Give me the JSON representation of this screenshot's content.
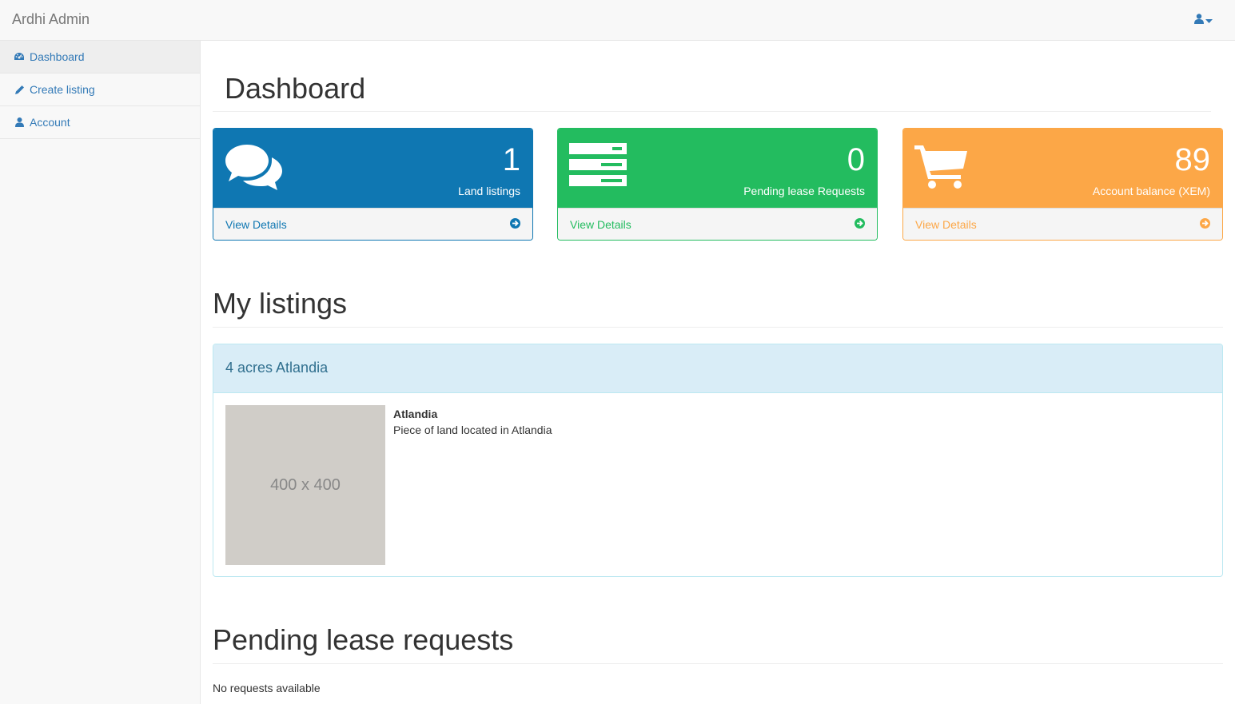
{
  "app": {
    "brand": "Ardhi Admin"
  },
  "navbar": {
    "user_icon": "user-icon",
    "caret_icon": "caret-down-icon"
  },
  "sidebar": {
    "items": [
      {
        "label": "Dashboard",
        "icon": "dashboard-icon",
        "active": true
      },
      {
        "label": "Create listing",
        "icon": "pencil-icon",
        "active": false
      },
      {
        "label": "Account",
        "icon": "user-icon",
        "active": false
      }
    ]
  },
  "main": {
    "title": "Dashboard",
    "cards": [
      {
        "value": "1",
        "label": "Land listings",
        "link": "View Details",
        "icon": "comments-icon",
        "color": "#0f77b2"
      },
      {
        "value": "0",
        "label": "Pending lease Requests",
        "link": "View Details",
        "icon": "server-icon",
        "color": "#23bc5f"
      },
      {
        "value": "89",
        "label": "Account balance (XEM)",
        "link": "View Details",
        "icon": "shopping-cart-icon",
        "color": "#fca747"
      }
    ],
    "listings_title": "My listings",
    "listings": [
      {
        "title": "4 acres Atlandia",
        "image_text": "400 x 400",
        "name": "Atlandia",
        "description": "Piece of land located in Atlandia"
      }
    ],
    "requests_title": "Pending lease requests",
    "requests_empty": "No requests available"
  }
}
